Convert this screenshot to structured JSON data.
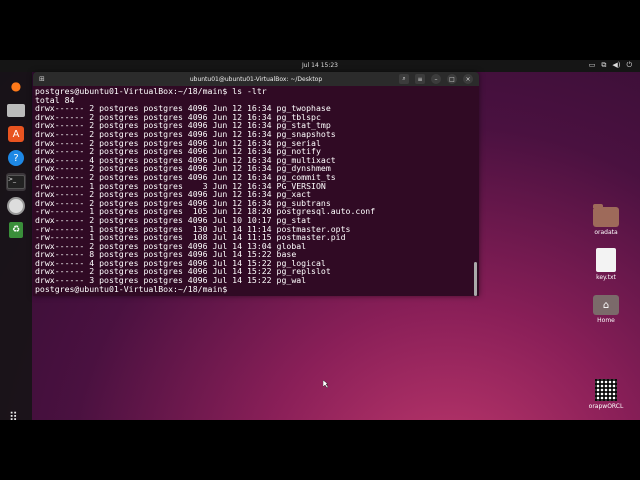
{
  "topbar": {
    "clock": "Jul 14  15:23"
  },
  "dock": {
    "apps": [
      {
        "name": "firefox-icon",
        "glyph": "🦊"
      },
      {
        "name": "files-icon",
        "glyph": "🗂"
      },
      {
        "name": "software-icon",
        "glyph": "A"
      },
      {
        "name": "help-icon",
        "glyph": "?"
      },
      {
        "name": "terminal-icon",
        "glyph": ">_"
      },
      {
        "name": "disc-icon",
        "glyph": "◎"
      },
      {
        "name": "trash-icon",
        "glyph": "♻"
      }
    ],
    "apps_grid_glyph": "⠿"
  },
  "terminal": {
    "title": "ubuntu01@ubuntu01-VirtualBox: ~/Desktop",
    "lines": [
      "postgres@ubuntu01-VirtualBox:~/18/main$ ls -ltr",
      "total 84",
      "drwx------ 2 postgres postgres 4096 Jun 12 16:34 pg_twophase",
      "drwx------ 2 postgres postgres 4096 Jun 12 16:34 pg_tblspc",
      "drwx------ 2 postgres postgres 4096 Jun 12 16:34 pg_stat_tmp",
      "drwx------ 2 postgres postgres 4096 Jun 12 16:34 pg_snapshots",
      "drwx------ 2 postgres postgres 4096 Jun 12 16:34 pg_serial",
      "drwx------ 2 postgres postgres 4096 Jun 12 16:34 pg_notify",
      "drwx------ 4 postgres postgres 4096 Jun 12 16:34 pg_multixact",
      "drwx------ 2 postgres postgres 4096 Jun 12 16:34 pg_dynshmem",
      "drwx------ 2 postgres postgres 4096 Jun 12 16:34 pg_commit_ts",
      "-rw------- 1 postgres postgres    3 Jun 12 16:34 PG_VERSION",
      "drwx------ 2 postgres postgres 4096 Jun 12 16:34 pg_xact",
      "drwx------ 2 postgres postgres 4096 Jun 12 16:34 pg_subtrans",
      "-rw------- 1 postgres postgres  105 Jun 12 18:20 postgresql.auto.conf",
      "drwx------ 2 postgres postgres 4096 Jul 10 10:17 pg_stat",
      "-rw------- 1 postgres postgres  130 Jul 14 11:14 postmaster.opts",
      "-rw------- 1 postgres postgres  108 Jul 14 11:15 postmaster.pid",
      "drwx------ 2 postgres postgres 4096 Jul 14 13:04 global",
      "drwx------ 8 postgres postgres 4096 Jul 14 15:22 base",
      "drwx------ 4 postgres postgres 4096 Jul 14 15:22 pg_logical",
      "drwx------ 2 postgres postgres 4096 Jul 14 15:22 pg_replslot",
      "drwx------ 3 postgres postgres 4096 Jul 14 15:22 pg_wal",
      "postgres@ubuntu01-VirtualBox:~/18/main$"
    ]
  },
  "desktop": {
    "icons": [
      {
        "label": "oradata",
        "kind": "folder"
      },
      {
        "label": "key.txt",
        "kind": "text"
      },
      {
        "label": "Home",
        "kind": "home"
      },
      {
        "label": "orapwORCL",
        "kind": "qr"
      }
    ]
  }
}
